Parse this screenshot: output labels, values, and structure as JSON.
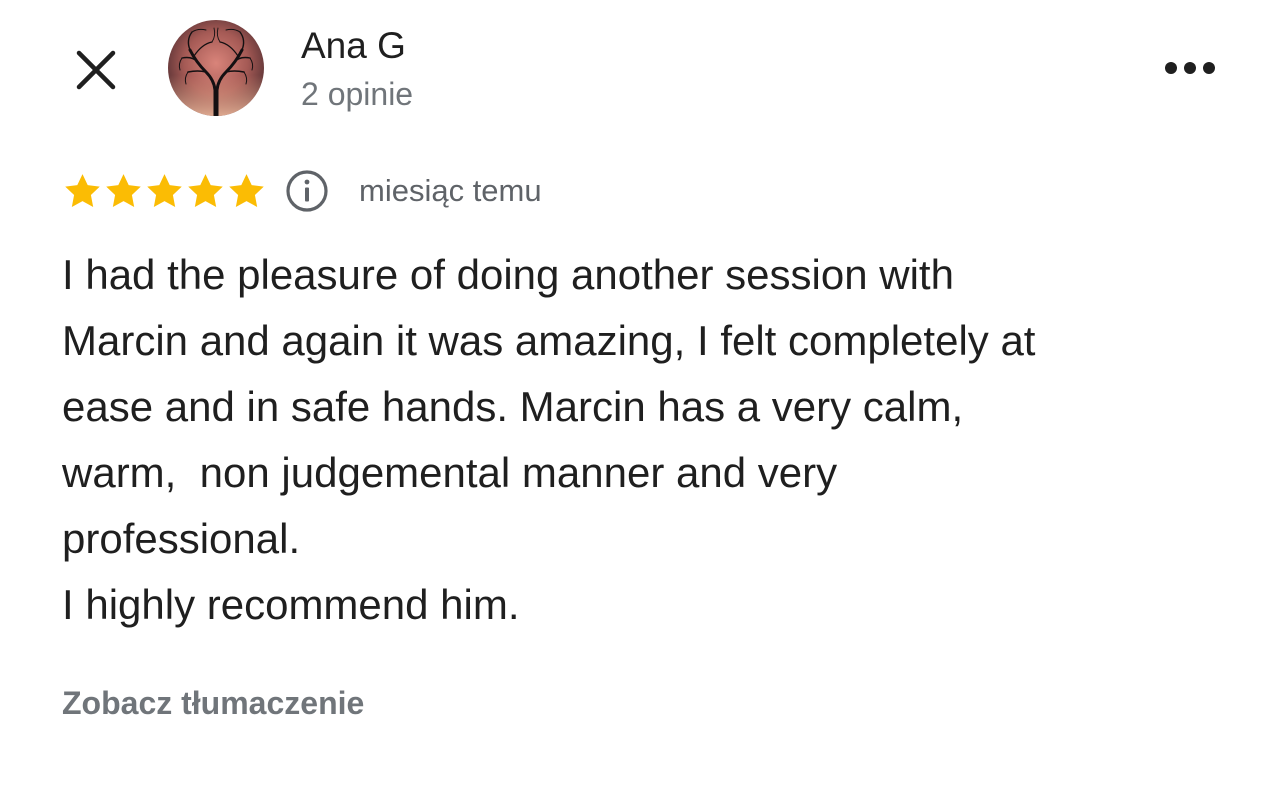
{
  "header": {
    "close_icon": "close-icon",
    "more_icon": "more-horizontal-icon",
    "author": {
      "name": "Ana G",
      "review_count": "2 opinie",
      "avatar_icon": "tree-silhouette-avatar"
    }
  },
  "review": {
    "rating": 5,
    "rating_max": 5,
    "star_color": "#fbbc04",
    "info_icon": "info-icon",
    "date": "miesiąc temu",
    "text": "I had the pleasure of doing another session with\nMarcin and again it was amazing, I felt completely at\nease and in safe hands. Marcin has a very calm,\nwarm,  non judgemental manner and very\nprofessional.\nI highly recommend him."
  },
  "actions": {
    "translate_label": "Zobacz tłumaczenie"
  }
}
